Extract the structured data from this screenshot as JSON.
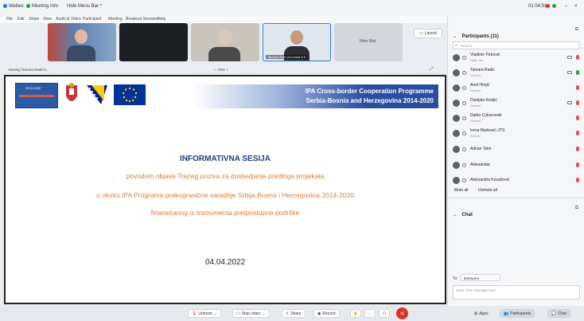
{
  "titlebar": {
    "app": "Webex",
    "meeting_info": "Meeting Info",
    "hide_menu": "Hide Menu Bar ^",
    "time": "01:04:51"
  },
  "menubar": [
    "File",
    "Edit",
    "Share",
    "View",
    "Audio & Video",
    "Participant",
    "Meeting",
    "Breakout Sessions",
    "Help"
  ],
  "video_strip": {
    "tiles": [
      {
        "label": ""
      },
      {
        "label": ""
      },
      {
        "label": ""
      },
      {
        "label": "Tamara Relić (Co-host) 5.5"
      }
    ],
    "more": "Nine Mat",
    "layout": "Layout"
  },
  "viewing": {
    "label": "Viewing Tamara Radić's...",
    "zoom": "— 75% +"
  },
  "slide": {
    "logo_text": "2014-2020",
    "banner_line1": "IPA Cross-border Cooperation Programme",
    "banner_line2": "Serbia-Bosnia and Herzegovina 2014-2020",
    "title": "INFORMATIVNA SESIJA",
    "line1": "povodom objave Trećeg poziva za dostavljanje predloga projekata",
    "line2": "u okviru IPA Programa prekogranične saradnje Srbija-Bosna i Hercegovina 2014-2020",
    "line3": "finansiranog iz Instrumenta pretpristupne podrške",
    "date": "04.04.2022"
  },
  "toolbar": {
    "unmute": "Unmute",
    "stop_video": "Stop video",
    "share": "Share",
    "record": "Record",
    "apps": "Apps",
    "participants": "Participants",
    "chat": "Chat"
  },
  "participants_panel": {
    "title": "Participants (11)",
    "search_placeholder": "Search",
    "people": [
      {
        "name": "Vladimir Petrović",
        "role": "Host, me"
      },
      {
        "name": "Tamara Radić",
        "role": "Cohost"
      },
      {
        "name": "Anel Hrnjić",
        "role": "Cohost"
      },
      {
        "name": "Danijela Kovijić",
        "role": "Cohost"
      },
      {
        "name": "Darko Cukurovski",
        "role": "Cohost"
      },
      {
        "name": "Irena Marković-JTS",
        "role": "Cohost"
      },
      {
        "name": "Adnan Tahir",
        "role": ""
      },
      {
        "name": "Aleksandar",
        "role": ""
      },
      {
        "name": "Aleksandra Kovačević",
        "role": ""
      }
    ],
    "mute_all": "Mute all",
    "unmute_all": "Unmute all"
  },
  "chat_panel": {
    "title": "Chat",
    "to_label": "To:",
    "to_value": "Everyone",
    "input_placeholder": "Enter chat message here"
  },
  "colors": {
    "banner": "#2b4ea3",
    "title_blue": "#1f3c88",
    "orange": "#e07a2c",
    "record_red": "#d9342b"
  }
}
